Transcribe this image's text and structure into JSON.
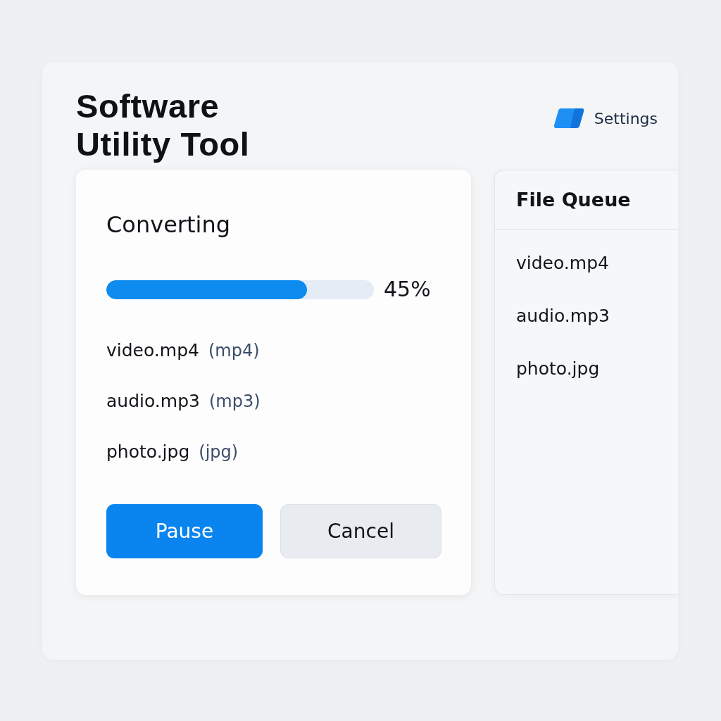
{
  "app": {
    "title": "Software Utility Tool",
    "settings_label": "Settings"
  },
  "conversion": {
    "heading": "Converting",
    "progress": {
      "level": 0.75,
      "reading": "45%"
    },
    "files": [
      {
        "name": "video.mp4",
        "type": "(mp4)"
      },
      {
        "name": "audio.mp3",
        "type": "(mp3)"
      },
      {
        "name": "photo.jpg",
        "type": "(jpg)"
      }
    ],
    "buttons": [
      {
        "label": "Pause",
        "kind": "primary"
      },
      {
        "label": "Cancel",
        "kind": "secondary"
      }
    ]
  },
  "file_queue": {
    "title": "File Queue",
    "items": [
      "video.mp4",
      "audio.mp3",
      "photo.jpg"
    ]
  }
}
